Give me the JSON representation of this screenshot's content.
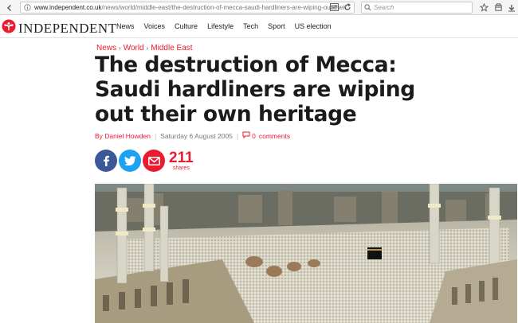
{
  "browser": {
    "url_host": "www.independent.co.uk",
    "url_path": "/news/world/middle-east/the-destruction-of-mecca-saudi-hardliners-are-wiping-out-their",
    "search_placeholder": "Search"
  },
  "site": {
    "logo_text": "INDEPENDENT",
    "nav": [
      "News",
      "Voices",
      "Culture",
      "Lifestyle",
      "Tech",
      "Sport",
      "US election"
    ]
  },
  "article": {
    "breadcrumb": [
      "News",
      "World",
      "Middle East"
    ],
    "headline": "The destruction of Mecca: Saudi hardliners are wiping out their own heritage",
    "author": "By Daniel Howden",
    "date": "Saturday 6 August 2005",
    "comments_count": "0",
    "comments_label": "comments",
    "share_count": "211",
    "share_label": "shares"
  },
  "colors": {
    "brand_red": "#ec1a2e",
    "facebook": "#3b5998",
    "twitter": "#1da1f2"
  }
}
